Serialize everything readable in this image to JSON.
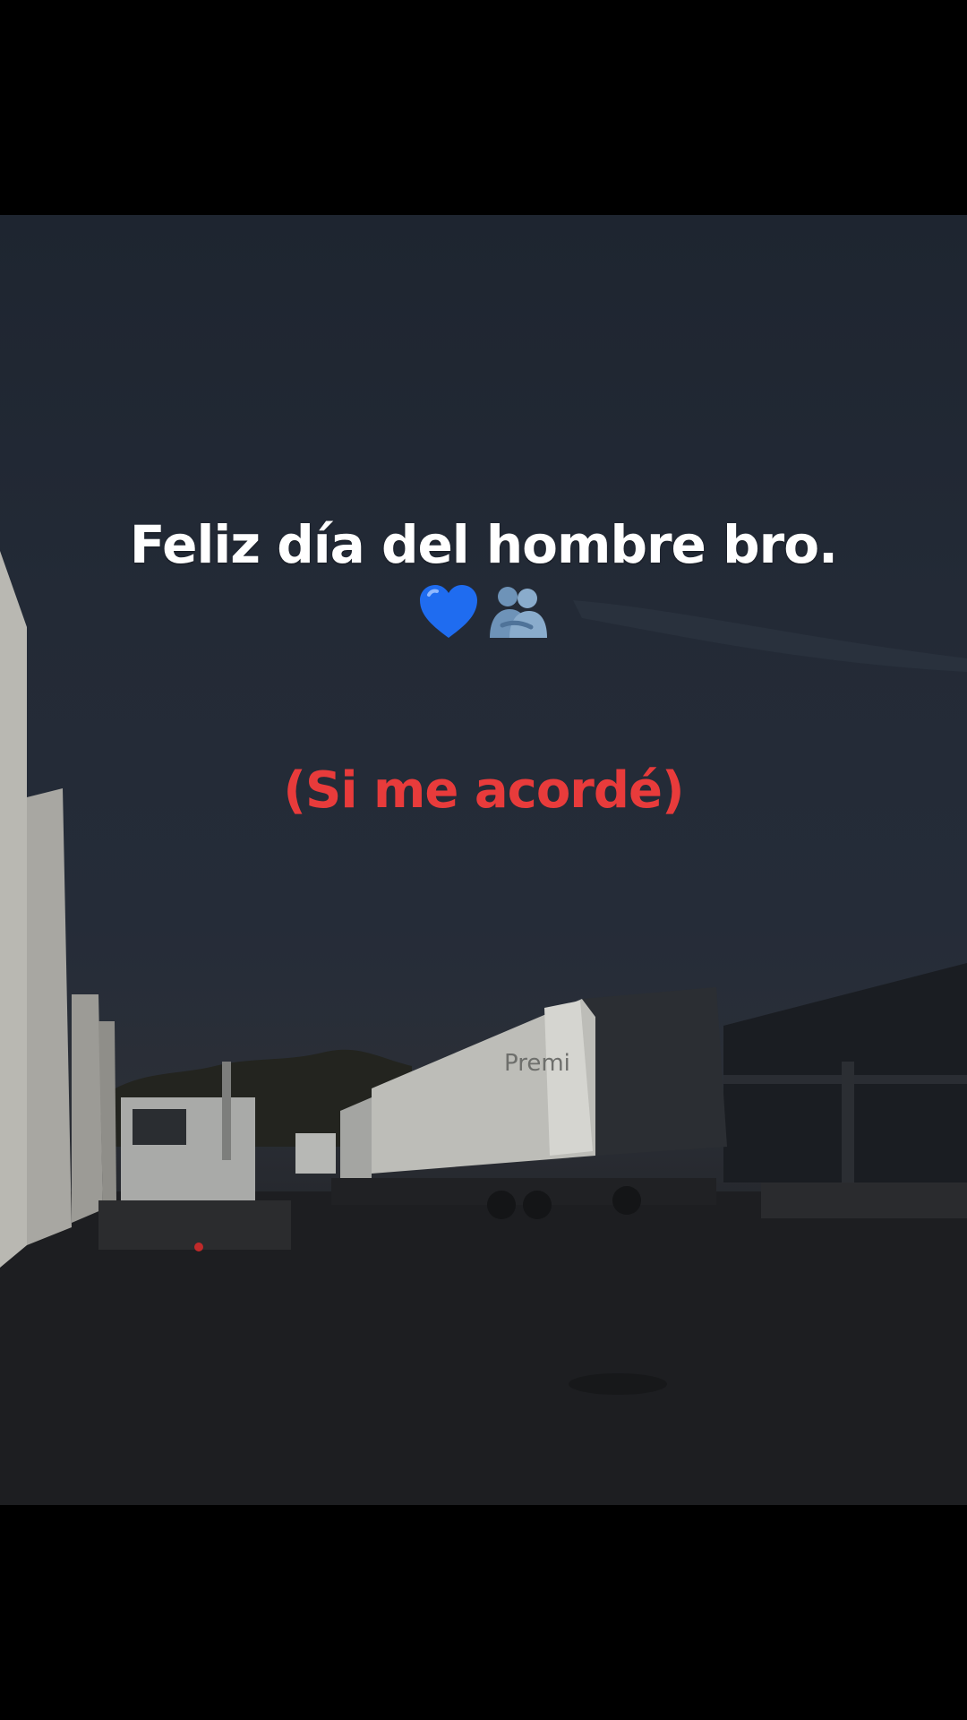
{
  "caption": {
    "main": "Feliz día del hombre bro.",
    "emojis": [
      "blue-heart-icon",
      "people-hugging-icon"
    ],
    "sub": "(Si me acordé)"
  },
  "scene": {
    "trailer_brand": "Premi"
  },
  "colors": {
    "caption_main": "#ffffff",
    "caption_sub": "#e83b3b",
    "heart": "#1f6cf0",
    "letterbox": "#000000"
  }
}
